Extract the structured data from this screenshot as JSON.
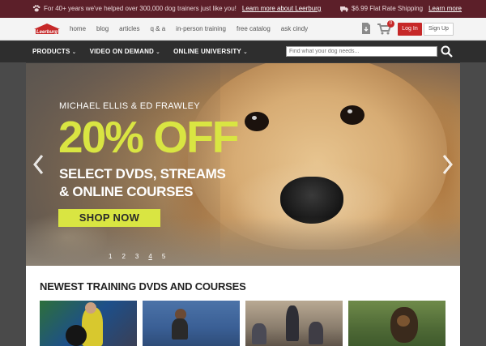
{
  "topbar": {
    "promo_text": "For 40+ years we've helped over 300,000 dog trainers just like you!",
    "promo_link": "Learn more about Leerburg",
    "shipping_text": "$6.99 Flat Rate Shipping",
    "shipping_link": "Learn more"
  },
  "header": {
    "logo_text": "Leerburg",
    "nav": [
      "home",
      "blog",
      "articles",
      "q & a",
      "in-person training",
      "free catalog",
      "ask cindy"
    ],
    "cart_count": "0",
    "login_label": "Log In",
    "signup_label": "Sign Up"
  },
  "mainnav": {
    "items": [
      "PRODUCTS",
      "VIDEO ON DEMAND",
      "ONLINE UNIVERSITY"
    ],
    "search_placeholder": "Find what your dog needs..."
  },
  "hero": {
    "subtitle": "MICHAEL ELLIS & ED FRAWLEY",
    "headline": "20% OFF",
    "line1": "SELECT DVDS, STREAMS",
    "line2": "& ONLINE COURSES",
    "cta": "SHOP NOW",
    "slides": [
      "1",
      "2",
      "3",
      "4",
      "5"
    ],
    "active_slide": "4"
  },
  "section": {
    "title": "NEWEST TRAINING DVDS AND COURSES"
  },
  "colors": {
    "topbar_bg": "#5c1f29",
    "accent_red": "#c62828",
    "accent_lime": "#d9e542",
    "nav_bg": "#2e2e2e"
  }
}
